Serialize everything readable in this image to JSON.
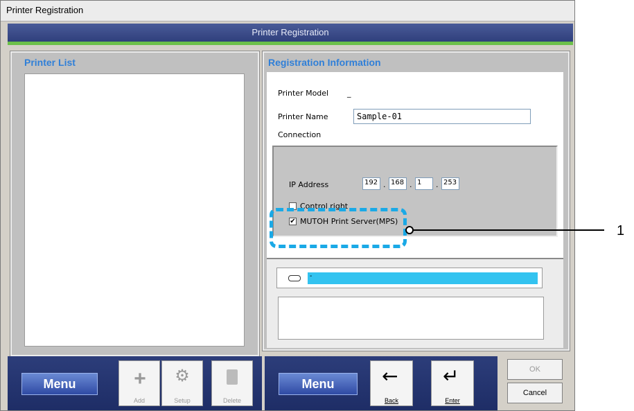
{
  "window": {
    "title": "Printer Registration"
  },
  "header": {
    "title": "Printer Registration"
  },
  "printer_list": {
    "title": "Printer List"
  },
  "registration": {
    "title": "Registration Information",
    "model_label": "Printer Model",
    "model_value": "_",
    "name_label": "Printer Name",
    "name_value": "Sample-01",
    "connection_label": "Connection",
    "ip_label": "IP Address",
    "ip_octets": [
      "192",
      "168",
      "1",
      "253"
    ],
    "control_right_label": "Control right",
    "control_right_checked": false,
    "mps_label": "MUTOH Print Server(MPS)",
    "mps_checked": true,
    "status_text": "-"
  },
  "left_toolbar": {
    "menu_label": "Menu",
    "add_label": "Add",
    "setup_label": "Setup",
    "delete_label": "Delete"
  },
  "right_toolbar": {
    "menu_label": "Menu",
    "back_label": "Back",
    "enter_label": "Enter",
    "ok_label": "OK",
    "cancel_label": "Cancel"
  },
  "annotation": {
    "number": "1"
  },
  "colors": {
    "accent_blue": "#2f7fd8",
    "status_cyan": "#33c3f0",
    "callout": "#1aa9e6",
    "header_green": "#6cc04a"
  }
}
